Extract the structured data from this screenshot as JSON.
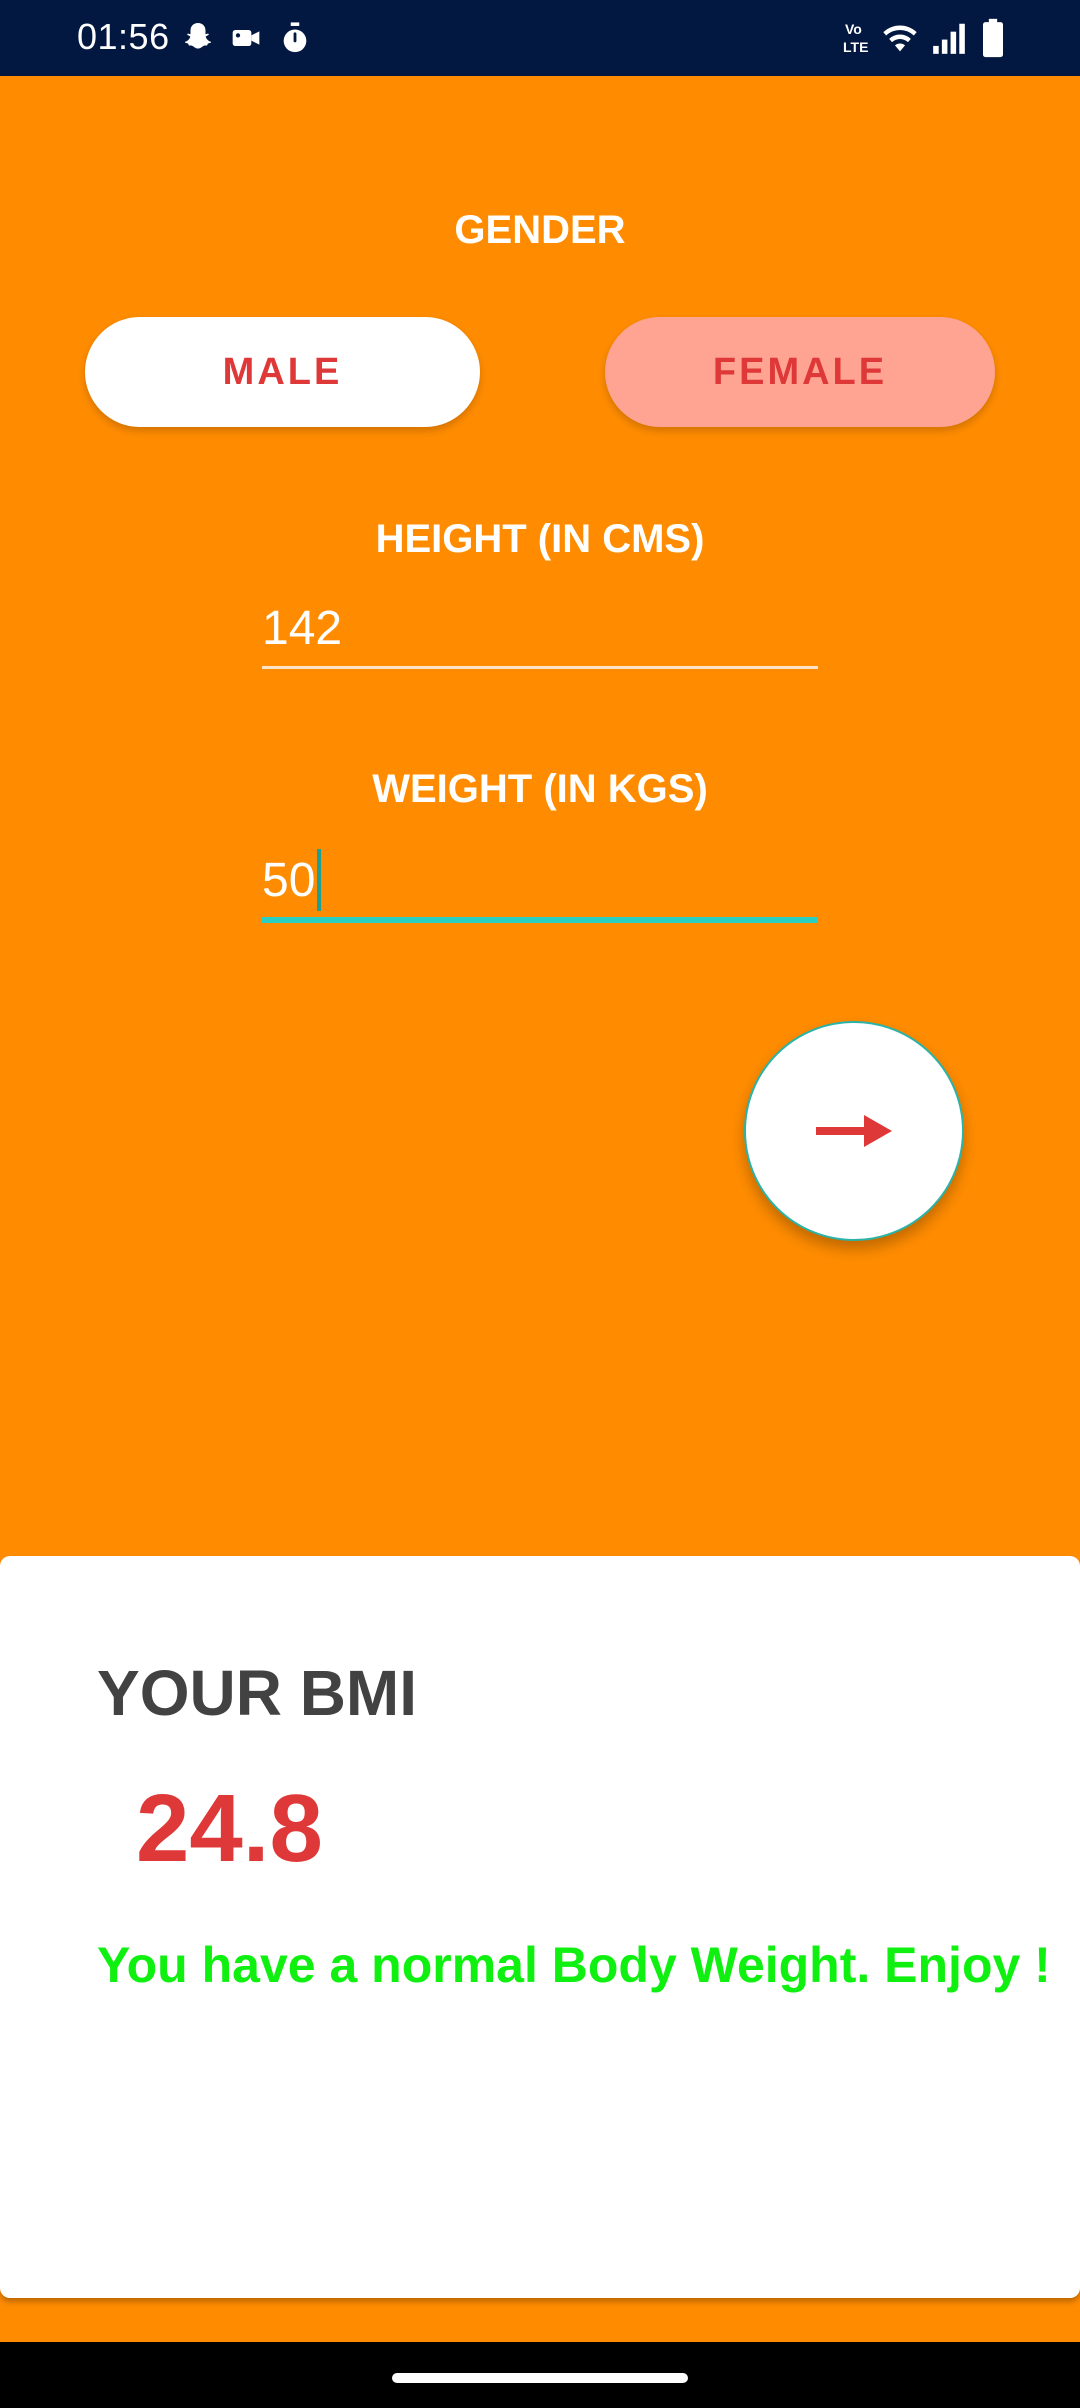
{
  "status_bar": {
    "time": "01:56",
    "left_icons": [
      "snapchat-icon",
      "video-camera-icon",
      "stopwatch-icon"
    ],
    "right_icons": [
      "volte-icon",
      "wifi-icon",
      "signal-icon",
      "battery-icon"
    ]
  },
  "gender": {
    "label": "GENDER",
    "male_label": "MALE",
    "female_label": "FEMALE"
  },
  "height": {
    "label": "HEIGHT (IN CMS)",
    "value": "142"
  },
  "weight": {
    "label": "WEIGHT (IN KGS)",
    "value": "50"
  },
  "calculate_button": {
    "icon": "arrow-right-icon"
  },
  "result": {
    "title": "YOUR BMI",
    "value": "24.8",
    "message": "You have a normal Body Weight. Enjoy !"
  },
  "colors": {
    "background": "#FF8C00",
    "status_bar": "#031840",
    "accent_red": "#DE3838",
    "female_pill": "#FFA493",
    "message_green": "#10F010",
    "input_focus": "#2BCFC2"
  }
}
